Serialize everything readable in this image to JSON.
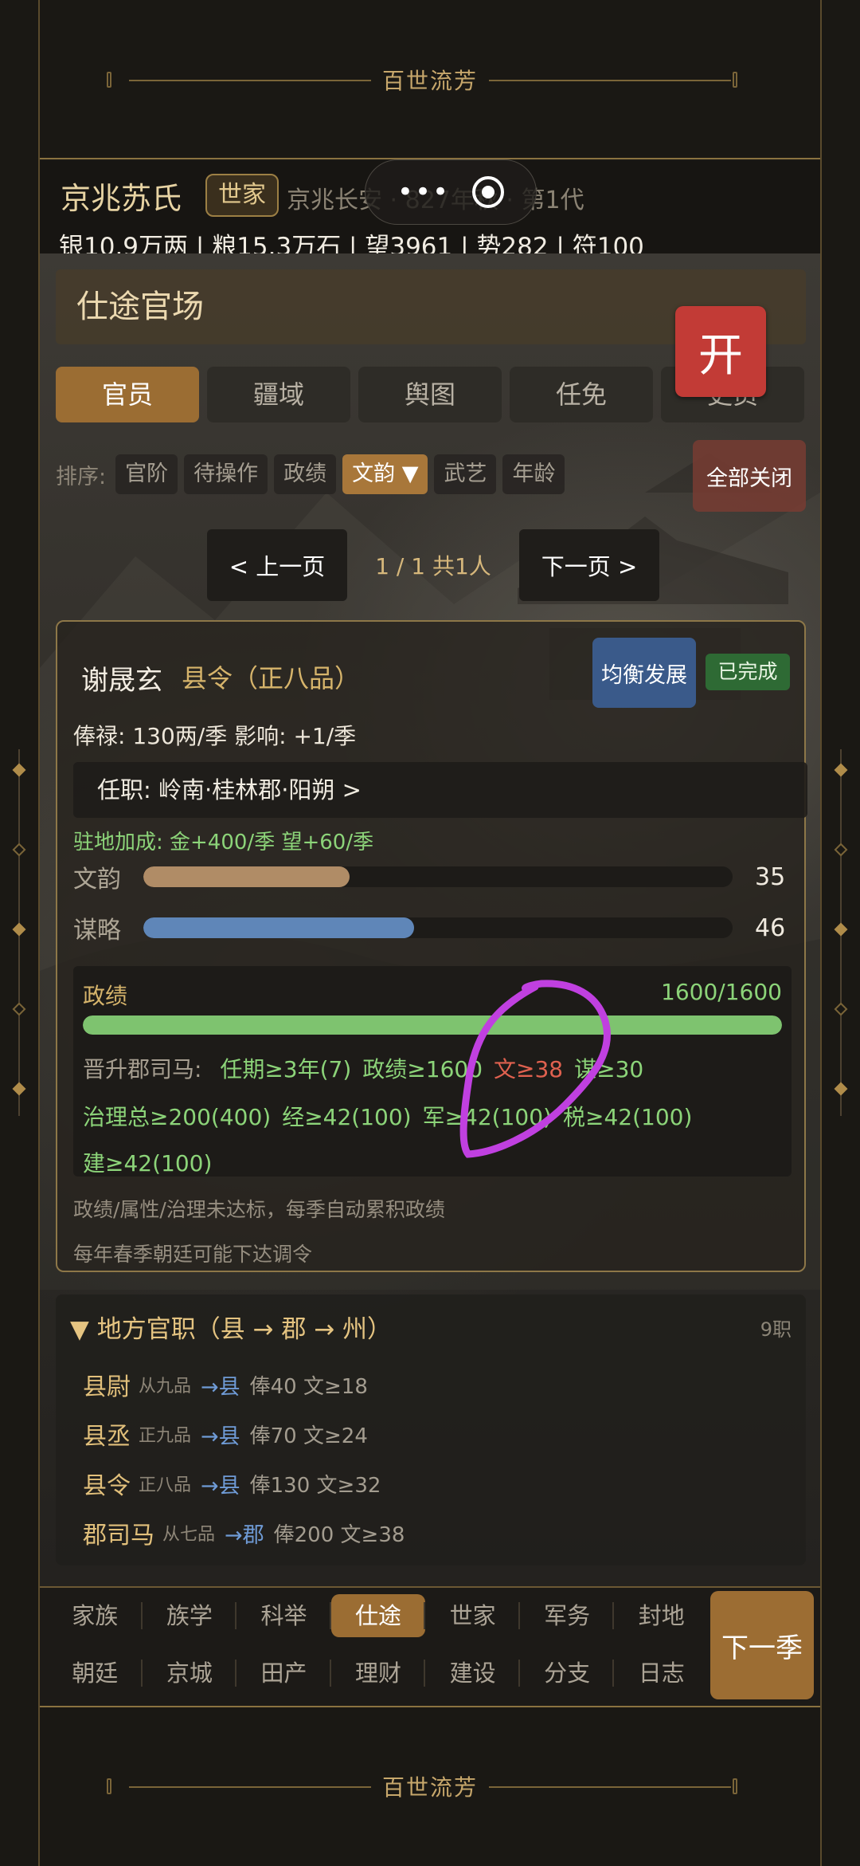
{
  "banner_title": "百世流芳",
  "header": {
    "family_name": "京兆苏氏",
    "family_tag": "世家",
    "family_info": "京兆长安 · 827年秋 · 第1代",
    "resources": "银10.9万两 | 粮15.3万石 | 望3961 | 势282 | 符100"
  },
  "panel": {
    "title": "仕途官场",
    "open_button": "开",
    "tabs": [
      {
        "label": "官员",
        "active": true
      },
      {
        "label": "疆域",
        "active": false
      },
      {
        "label": "舆图",
        "active": false
      },
      {
        "label": "任免",
        "active": false
      },
      {
        "label": "吏员",
        "active": false
      }
    ],
    "sort_label": "排序:",
    "sort_options": [
      {
        "label": "官阶",
        "active": false
      },
      {
        "label": "待操作",
        "active": false
      },
      {
        "label": "政绩",
        "active": false
      },
      {
        "label": "文韵 ▼",
        "active": true
      },
      {
        "label": "武艺",
        "active": false
      },
      {
        "label": "年龄",
        "active": false
      }
    ],
    "close_all": "全部关闭",
    "pager": {
      "prev": "< 上一页",
      "info": "1 / 1  共1人",
      "next": "下一页 >"
    }
  },
  "official": {
    "name": "谢晟玄",
    "rank": "县令（正八品）",
    "policy_button": "均衡发展",
    "status_badge": "已完成",
    "salary": "俸禄: 130两/季   影响: +1/季",
    "post": "任职: 岭南·桂林郡·阳朔   >",
    "bonus": "驻地加成: 金+400/季   望+60/季",
    "stats": [
      {
        "label": "文韵",
        "value": "35",
        "fraction": 0.35,
        "color": "#b08c66"
      },
      {
        "label": "谋略",
        "value": "46",
        "fraction": 0.46,
        "color": "#5f86b8"
      }
    ],
    "performance": {
      "label": "政绩",
      "value": "1600/1600",
      "fraction": 1.0,
      "promotion_prefix": "晋升郡司马:",
      "req_line1": [
        {
          "text": "任期≥3年(7)",
          "ok": true
        },
        {
          "text": "政绩≥1600",
          "ok": true
        },
        {
          "text": "文≥38",
          "ok": false
        },
        {
          "text": "谋≥30",
          "ok": true
        }
      ],
      "req_line2": [
        {
          "text": "治理总≥200(400)",
          "ok": true
        },
        {
          "text": "经≥42(100)",
          "ok": true
        },
        {
          "text": "军≥42(100)",
          "ok": true
        },
        {
          "text": "税≥42(100)",
          "ok": true
        }
      ],
      "req_line3": [
        {
          "text": "建≥42(100)",
          "ok": true
        }
      ]
    },
    "note1": "政绩/属性/治理未达标，每季自动累积政绩",
    "note2": "每年春季朝廷可能下达调令"
  },
  "regional_posts": {
    "title": "▼ 地方官职（县 → 郡 → 州）",
    "count": "9职",
    "items": [
      {
        "name": "县尉",
        "grade": "从九品",
        "arrow": "→县",
        "info": "俸40  文≥18"
      },
      {
        "name": "县丞",
        "grade": "正九品",
        "arrow": "→县",
        "info": "俸70  文≥24"
      },
      {
        "name": "县令",
        "grade": "正八品",
        "arrow": "→县",
        "info": "俸130  文≥32"
      },
      {
        "name": "郡司马",
        "grade": "从七品",
        "arrow": "→郡",
        "info": "俸200  文≥38"
      }
    ]
  },
  "bottom_nav": {
    "row1": [
      {
        "label": "家族",
        "active": false
      },
      {
        "label": "族学",
        "active": false
      },
      {
        "label": "科举",
        "active": false
      },
      {
        "label": "仕途",
        "active": true
      },
      {
        "label": "世家",
        "active": false
      },
      {
        "label": "军务",
        "active": false
      },
      {
        "label": "封地",
        "active": false
      }
    ],
    "row2": [
      {
        "label": "朝廷",
        "active": false
      },
      {
        "label": "京城",
        "active": false
      },
      {
        "label": "田产",
        "active": false
      },
      {
        "label": "理财",
        "active": false
      },
      {
        "label": "建设",
        "active": false
      },
      {
        "label": "分支",
        "active": false
      },
      {
        "label": "日志",
        "active": false
      }
    ],
    "next_season": "下一季"
  }
}
